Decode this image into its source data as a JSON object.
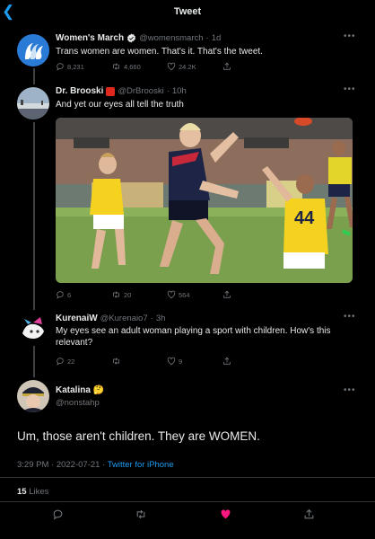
{
  "header": {
    "title": "Tweet"
  },
  "tweets": [
    {
      "name": "Women's March",
      "handle": "@womensmarch",
      "time": "1d",
      "text": "Trans women are women. That's it. That's the tweet.",
      "replies": "8,231",
      "retweets": "4,660",
      "likes": "24.2K"
    },
    {
      "name": "Dr. Brooski",
      "handle": "@DrBrooski",
      "time": "10h",
      "text": "And yet our eyes all tell the truth",
      "replies": "6",
      "retweets": "20",
      "likes": "564",
      "photo": {
        "jersey_number": "44"
      }
    },
    {
      "name": "KurenaiW",
      "handle": "@Kurenaio7",
      "time": "3h",
      "text_line1": "My eyes see an adult woman playing a sport with children. How's this",
      "text_line2": "relevant?",
      "replies": "22",
      "retweets": "",
      "likes": "9"
    }
  ],
  "focused_tweet": {
    "name": "Katalina",
    "handle": "@nonstahp",
    "text": "Um, those aren't children. They are WOMEN.",
    "time": "3:29 PM · 2022-07-21 ·",
    "source": "Twitter for iPhone",
    "likes_count": "15",
    "likes_label": "Likes"
  },
  "icons": {
    "back": "chevron-left-icon",
    "verified": "verified-badge-icon",
    "flag": "red-square-emoji-icon",
    "reply": "reply-icon",
    "retweet": "retweet-icon",
    "like": "heart-icon",
    "share": "share-icon",
    "more": "more-icon"
  },
  "colors": {
    "accent": "#1d9bf0",
    "liked": "#f91880",
    "background": "#000000",
    "muted": "#71767b"
  }
}
